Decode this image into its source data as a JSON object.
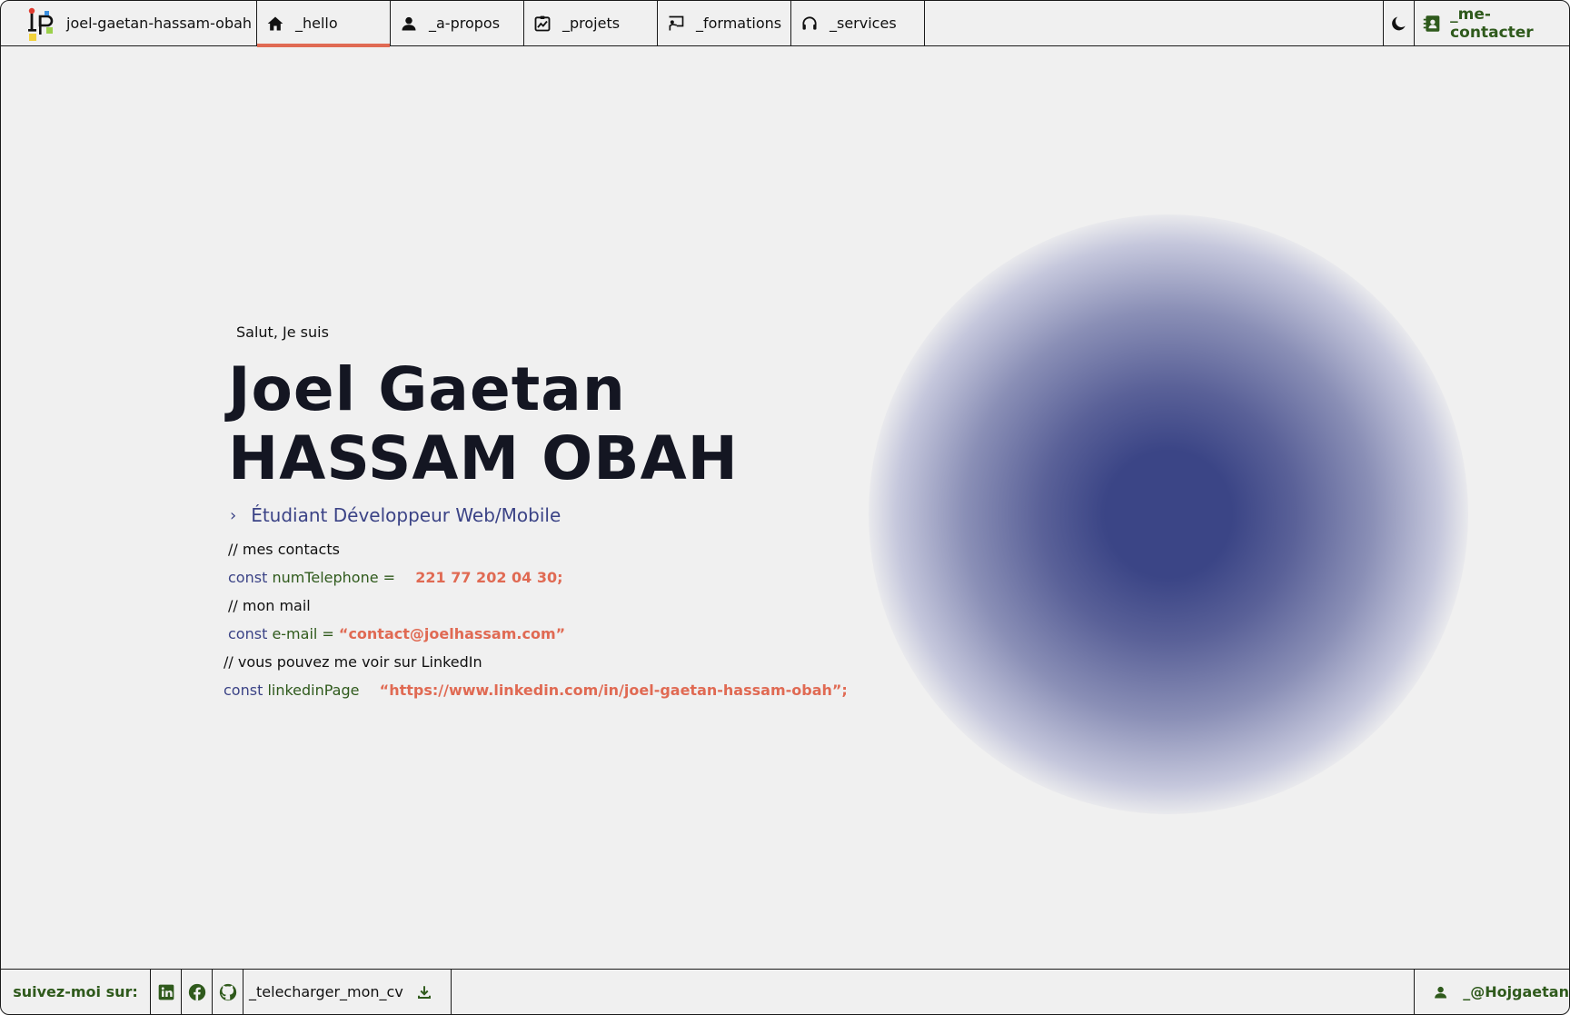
{
  "brand": {
    "name": "joel-gaetan-hassam-obah"
  },
  "nav": {
    "tabs": [
      {
        "label": "_hello",
        "icon": "home-icon",
        "active": true
      },
      {
        "label": "_a-propos",
        "icon": "user-icon",
        "active": false
      },
      {
        "label": "_projets",
        "icon": "chart-icon",
        "active": false
      },
      {
        "label": "_formations",
        "icon": "teacher-icon",
        "active": false
      },
      {
        "label": "_services",
        "icon": "headset-icon",
        "active": false
      }
    ],
    "theme_icon": "moon-icon",
    "contact_label": "_me-contacter",
    "contact_icon": "contact-card-icon"
  },
  "hero": {
    "greeting": "Salut, Je suis",
    "name_line1": "Joel Gaetan",
    "name_line2": "HASSAM OBAH",
    "role": "Étudiant Développeur Web/Mobile"
  },
  "code": {
    "comment_contacts": "// mes contacts",
    "phone_kw": "const",
    "phone_var": "numTelephone =",
    "phone_value": "221 77 202 04 30;",
    "comment_mail": "// mon mail",
    "mail_kw": "const",
    "mail_var": "e-mail =",
    "mail_value": "“contact@joelhassam.com”",
    "comment_linkedin": "// vous pouvez me voir sur LinkedIn",
    "linkedin_kw": "const",
    "linkedin_var": "linkedinPage",
    "linkedin_value": "“https://www.linkedin.com/in/joel-gaetan-hassam-obah”;"
  },
  "footer": {
    "follow_label": "suivez-moi sur:",
    "socials": [
      "linkedin-icon",
      "facebook-icon",
      "github-icon"
    ],
    "cv_label": "_telecharger_mon_cv",
    "handle_label": "_@Hojgaetan"
  },
  "colors": {
    "accent_orange": "#e06a53",
    "accent_green": "#2f5a1c",
    "accent_blue": "#3b4386",
    "background": "#f0f0f0"
  }
}
